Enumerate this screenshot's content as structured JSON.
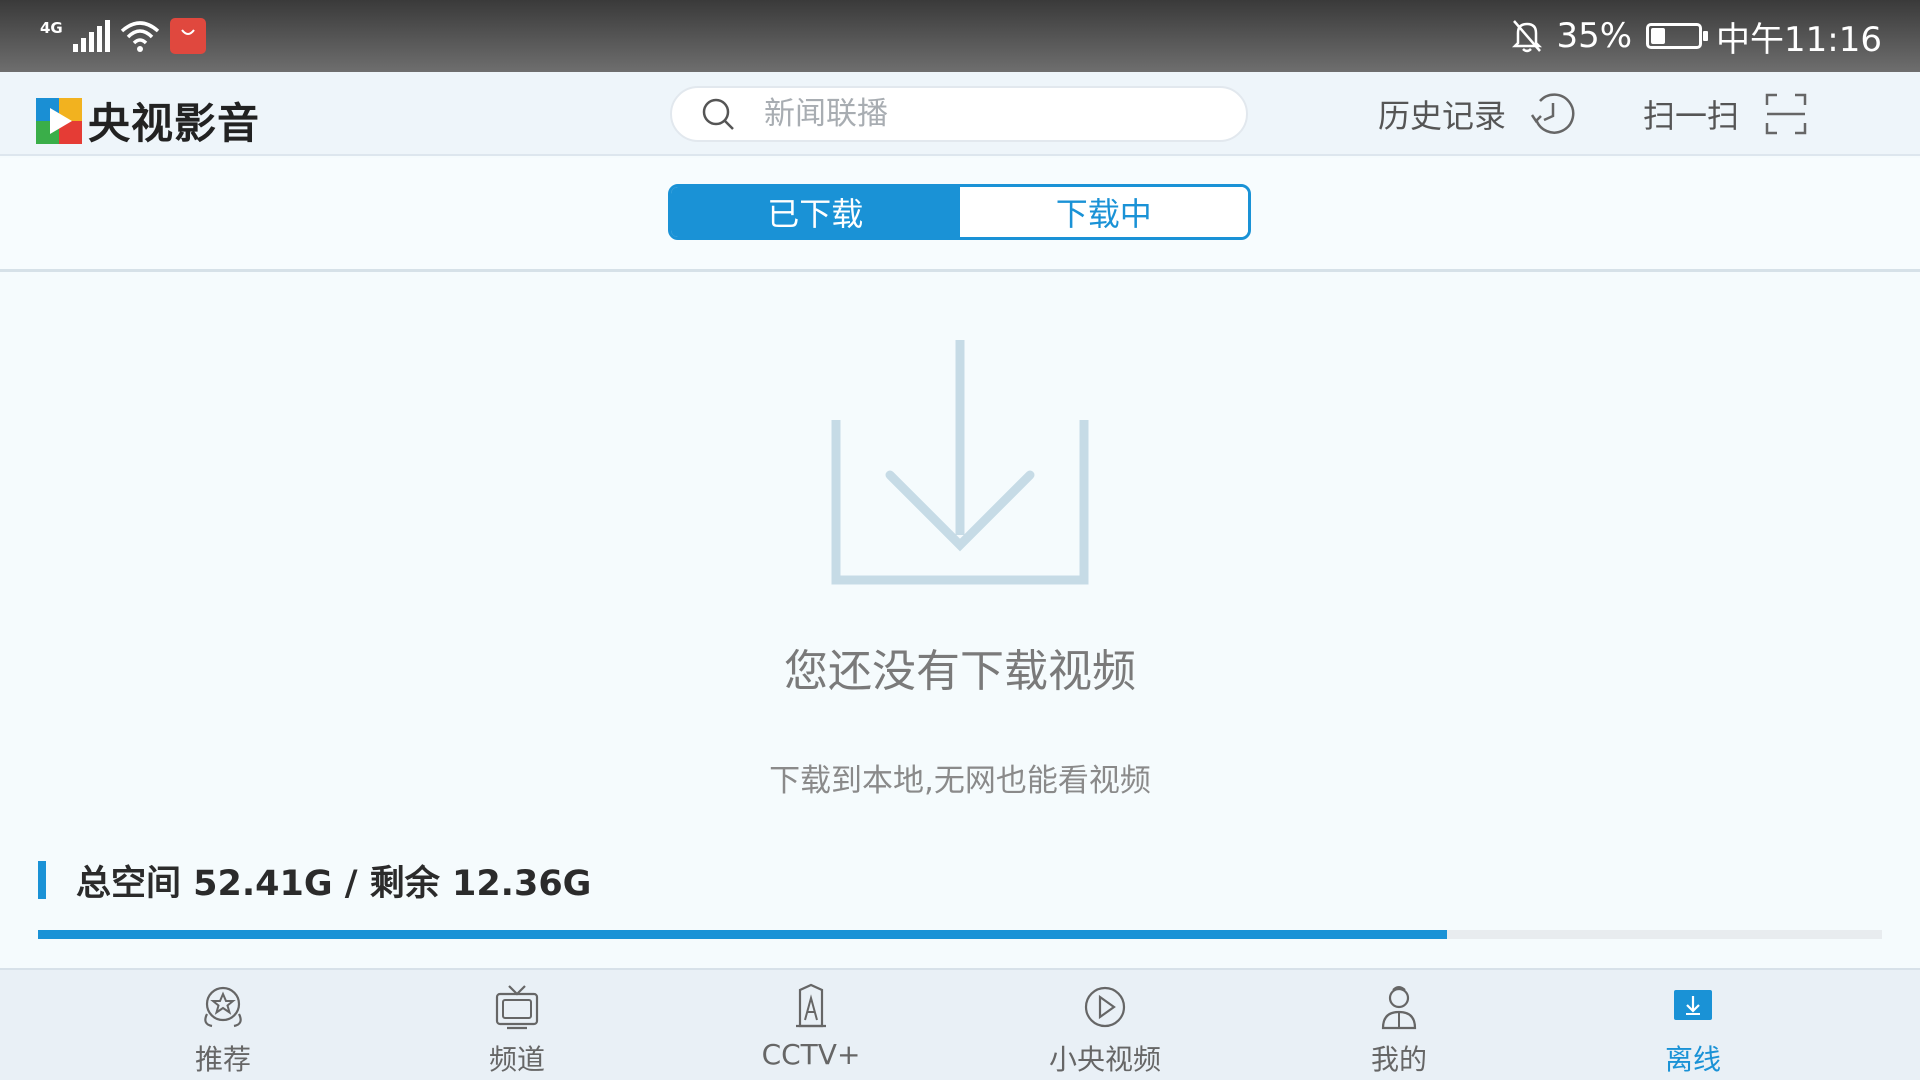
{
  "status_bar": {
    "network": "4G",
    "battery_percent": "35%",
    "battery_level": 0.35,
    "time": "中午11:16"
  },
  "header": {
    "app_name": "央视影音",
    "search_placeholder": "新闻联播",
    "history_label": "历史记录",
    "scan_label": "扫一扫"
  },
  "tabs": {
    "downloaded": "已下载",
    "downloading": "下载中"
  },
  "empty_state": {
    "title": "您还没有下载视频",
    "subtitle": "下载到本地,无网也能看视频"
  },
  "storage": {
    "text": "总空间 52.41G / 剩余 12.36G",
    "used_fraction": 0.764
  },
  "bottom_nav": [
    {
      "label": "推荐",
      "icon": "recommend-icon"
    },
    {
      "label": "频道",
      "icon": "tv-icon"
    },
    {
      "label": "CCTV+",
      "icon": "cctv-plus-icon"
    },
    {
      "label": "小央视频",
      "icon": "play-circle-icon"
    },
    {
      "label": "我的",
      "icon": "user-icon"
    },
    {
      "label": "离线",
      "icon": "download-icon"
    }
  ],
  "colors": {
    "accent": "#1a92d6",
    "empty_icon": "#c6dbe6"
  }
}
